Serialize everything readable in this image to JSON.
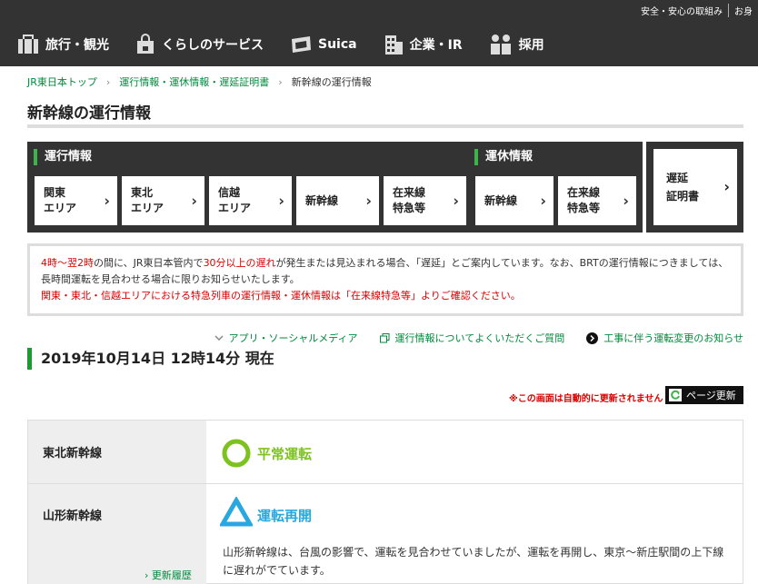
{
  "header": {
    "utility_links": [
      "安全・安心の取組み",
      "お身"
    ],
    "nav": [
      {
        "label": "旅行・観光",
        "icon": "suitcase-icon"
      },
      {
        "label": "くらしのサービス",
        "icon": "shopping-bag-icon"
      },
      {
        "label": "Suica",
        "icon": "card-icon"
      },
      {
        "label": "企業・IR",
        "icon": "building-icon"
      },
      {
        "label": "採用",
        "icon": "people-icon"
      }
    ]
  },
  "breadcrumb": [
    "JR東日本トップ",
    "運行情報・運休情報・遅延証明書",
    "新幹線の運行情報"
  ],
  "page_title": "新幹線の運行情報",
  "area_nav": {
    "operation_label": "運行情報",
    "suspension_label": "運休情報",
    "operation_buttons": [
      [
        "関東",
        "エリア"
      ],
      [
        "東北",
        "エリア"
      ],
      [
        "信越",
        "エリア"
      ],
      [
        "新幹線"
      ],
      [
        "在来線",
        "特急等"
      ]
    ],
    "suspension_buttons": [
      [
        "新幹線"
      ],
      [
        "在来線",
        "特急等"
      ]
    ],
    "certificate_button": [
      "遅延",
      "証明書"
    ]
  },
  "notice": {
    "hours": "4時～翌2時",
    "t1": "の間に、JR東日本管内で",
    "delay": "30分以上の遅れ",
    "t2": "が発生または見込まれる場合、「遅延」とご案内しています。なお、BRTの運行情報につきましては、長時間運転を見合わせる場合に限りお知らせいたします。",
    "line3": "関東・東北・信越エリアにおける特急列車の運行情報・運休情報は「在来線特急等」よりご確認ください。"
  },
  "links": [
    "アプリ・ソーシャルメディア",
    "運行情報についてよくいただくご質問",
    "工事に伴う運転変更のお知らせ"
  ],
  "datetime": "2019年10月14日 12時14分 現在",
  "auto_note": "※この画面は自動的に更新されません",
  "refresh_label": "ページ更新",
  "lines": [
    {
      "name": "東北新幹線",
      "status": "平常運転",
      "status_color": "#7dc21e"
    },
    {
      "name": "山形新幹線",
      "status": "運転再開",
      "status_color": "#29a8e0",
      "detail": "山形新幹線は、台風の影響で、運転を見合わせていましたが、運転を再開し、東京～新庄駅間の上下線に遅れがでています。",
      "history_label": "更新履歴"
    }
  ],
  "colors": {
    "header_bg": "#333333",
    "accent_green": "#3cb44b",
    "link_green": "#008a3c",
    "alert_red": "#dd0000"
  }
}
